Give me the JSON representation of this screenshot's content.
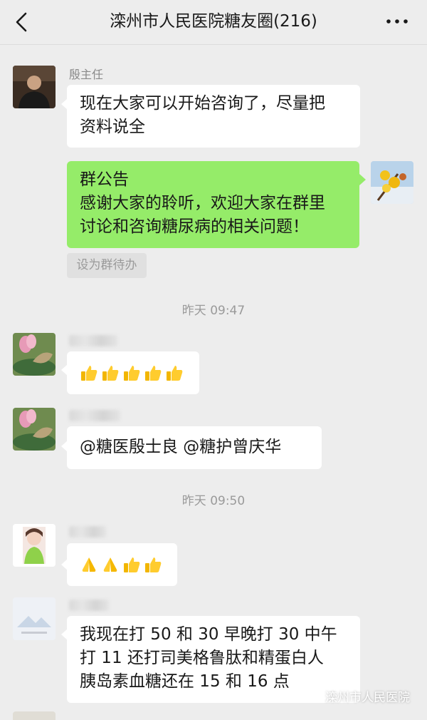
{
  "header": {
    "title": "滦州市人民医院糖友圈(216)"
  },
  "messages": {
    "m1": {
      "sender": "殷主任",
      "lines": [
        "现在大家可以开始咨询了，尽量把",
        "资料说全"
      ]
    },
    "m2": {
      "lines": [
        "群公告",
        "感谢大家的聆听，欢迎大家在群里",
        "讨论和咨询糖尿病的相关问题！"
      ],
      "action": "设为群待办"
    },
    "m3": {
      "emoji": [
        "thumbs-up",
        "thumbs-up",
        "thumbs-up",
        "thumbs-up",
        "thumbs-up"
      ]
    },
    "m4": {
      "text": "@糖医殷士良 @糖护曾庆华"
    },
    "m5": {
      "emoji": [
        "pray",
        "pray",
        "thumbs-up",
        "thumbs-up"
      ]
    },
    "m6": {
      "lines": [
        "我现在打 50 和 30 早晚打 30 中午",
        "打 11 还打司美格鲁肽和精蛋白人",
        "胰岛素血糖还在 15 和 16 点"
      ]
    }
  },
  "timestamps": [
    "昨天 09:47",
    "昨天 09:50"
  ],
  "watermark": {
    "text": "滦州市人民医院"
  },
  "colors": {
    "background": "#ededed",
    "self_bubble": "#95ec69",
    "other_bubble": "#ffffff"
  }
}
